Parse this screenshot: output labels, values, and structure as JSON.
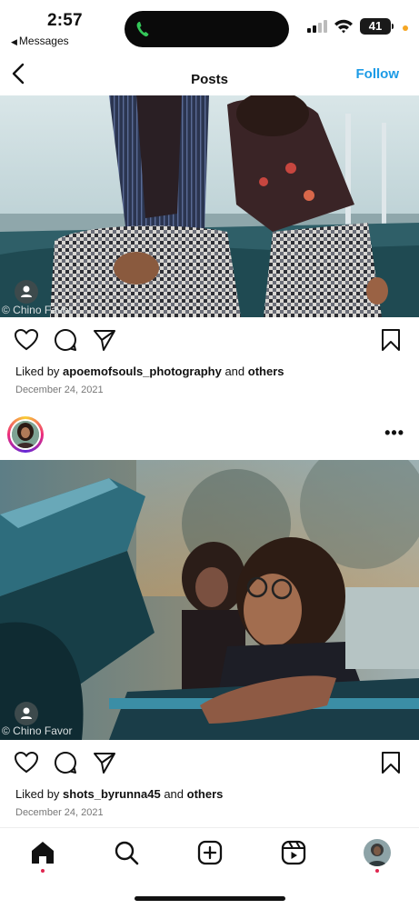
{
  "status_bar": {
    "time": "2:57",
    "back_app": "Messages",
    "battery": "41"
  },
  "nav": {
    "title": "Posts",
    "follow_label": "Follow"
  },
  "posts": [
    {
      "watermark": "© Chino Favor",
      "liked_by_prefix": "Liked by ",
      "liked_by_user": "apoemofsouls_photography",
      "liked_by_join": " and ",
      "liked_by_others": "others",
      "date": "December 24, 2021"
    },
    {
      "watermark": "© Chino Favor",
      "liked_by_prefix": "Liked by ",
      "liked_by_user": "shots_byrunna45",
      "liked_by_join": " and ",
      "liked_by_others": "others",
      "date": "December 24, 2021",
      "more_label": "•••"
    }
  ],
  "icons": [
    "back-chevron",
    "heart",
    "comment",
    "share",
    "bookmark",
    "more",
    "home",
    "search",
    "new-post",
    "reels",
    "profile"
  ],
  "colors": {
    "accent": "#1c9be6",
    "notification": "#e0264f"
  }
}
